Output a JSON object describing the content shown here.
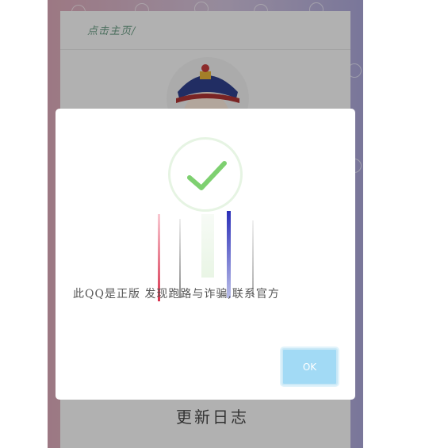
{
  "page": {
    "breadcrumb": "点击主页/",
    "changelog_title": "更新日志"
  },
  "dialog": {
    "icon": "checkmark-icon",
    "message": "此QQ是正版    发现跑路与诈骗,联系官方",
    "ok_label": "OK"
  },
  "colors": {
    "check_green": "#7ed070",
    "ok_button": "#a2daf5"
  }
}
